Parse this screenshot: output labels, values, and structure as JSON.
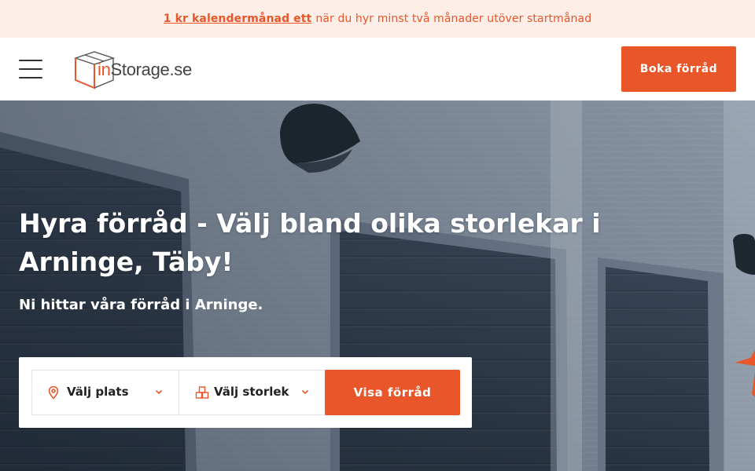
{
  "promo": {
    "link_text": "1 kr kalendermånad ett",
    "text": "när du hyr minst två månader utöver startmånad"
  },
  "header": {
    "logo_prefix": "in",
    "logo_suffix": "Storage.se",
    "cta_label": "Boka förråd"
  },
  "hero": {
    "title": "Hyra förråd - Välj bland olika storlekar i Arninge, Täby!",
    "subtitle": "Ni hittar våra förråd i Arninge."
  },
  "search": {
    "location_label": "Välj plats",
    "size_label": "Välj storlek",
    "submit_label": "Visa förråd"
  },
  "colors": {
    "accent": "#e8562a",
    "promo_bg": "#fdeee7",
    "text_dark": "#222222"
  },
  "icons": {
    "menu": "hamburger-menu-icon",
    "location": "map-pin-icon",
    "size": "boxes-icon",
    "dropdown": "chevron-down-icon"
  }
}
